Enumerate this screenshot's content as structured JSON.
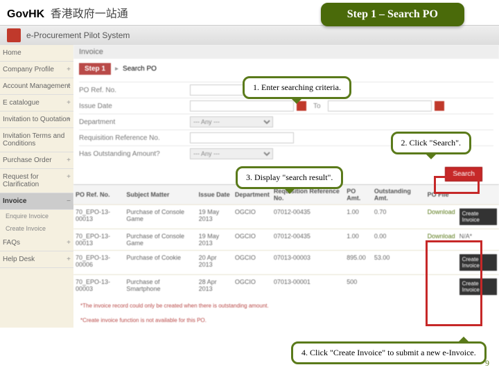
{
  "header": {
    "brand": "GovHK",
    "cn": "香港政府一站通"
  },
  "step_badge": "Step 1 – Search PO",
  "system_name": "e-Procurement Pilot System",
  "sidebar": {
    "items": [
      {
        "label": "Home"
      },
      {
        "label": "Company Profile"
      },
      {
        "label": "Account Management"
      },
      {
        "label": "E catalogue"
      },
      {
        "label": "Invitation to Quotation"
      },
      {
        "label": "Invitation Terms and Conditions"
      },
      {
        "label": "Purchase Order"
      },
      {
        "label": "Request for Clarification"
      },
      {
        "label": "Invoice",
        "active": true,
        "subs": [
          "Enquire Invoice",
          "Create Invoice"
        ]
      },
      {
        "label": "FAQs"
      },
      {
        "label": "Help Desk"
      }
    ]
  },
  "tab": "Invoice",
  "crumb": {
    "step": "Step 1",
    "title": "Search PO"
  },
  "form": {
    "po_ref": "PO Ref. No.",
    "issue_date": "Issue Date",
    "to": "To",
    "department": "Department",
    "dept_val": "--- Any ---",
    "req_ref": "Requisition Reference No.",
    "outstanding": "Has Outstanding Amount?",
    "out_val": "--- Any ---"
  },
  "buttons": {
    "search": "Search",
    "create_invoice": "Create Invoice"
  },
  "table": {
    "cols": [
      "PO Ref. No.",
      "Subject Matter",
      "Issue Date",
      "Department",
      "Requisition Reference No.",
      "PO Amt.",
      "Outstanding Amt.",
      "PO File",
      ""
    ],
    "rows": [
      {
        "c": [
          "70_EPO-13-00013",
          "Purchase of Console Game",
          "19 May 2013",
          "OGCIO",
          "07012-00435",
          "1.00",
          "0.70",
          "Download",
          "Create Invoice"
        ]
      },
      {
        "c": [
          "70_EPO-13-00013",
          "Purchase of Console Game",
          "19 May 2013",
          "OGCIO",
          "07012-00435",
          "1.00",
          "0.00",
          "Download",
          "N/A*"
        ]
      },
      {
        "c": [
          "70_EPO-13-00006",
          "Purchase of Cookie",
          "20 Apr 2013",
          "OGCIO",
          "07013-00003",
          "895.00",
          "53.00",
          "",
          "Create Invoice"
        ]
      },
      {
        "c": [
          "70_EPO-13-00003",
          "Purchase of Smartphone",
          "28 Apr 2013",
          "OGCIO",
          "07013-00001",
          "500",
          "",
          "",
          "Create Invoice"
        ]
      }
    ]
  },
  "footnotes": [
    "*The invoice record could only be created when there is outstanding amount.",
    "*Create invoice function is not available for this PO."
  ],
  "callouts": {
    "c1": "1. Enter searching criteria.",
    "c2": "2. Click \"Search\".",
    "c3": "3. Display \"search result\".",
    "c4": "4. Click \"Create Invoice\" to submit a new e-Invoice."
  },
  "page_number": "9"
}
